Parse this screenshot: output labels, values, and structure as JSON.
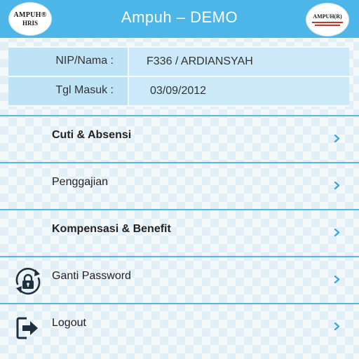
{
  "header": {
    "title": "Ampuh – DEMO",
    "logo_left_line1": "AMPUH®",
    "logo_left_line2": "HRIS",
    "logo_right_text": "AMPUH(R)",
    "background_color": "#4bb6e7"
  },
  "info": {
    "rows": [
      {
        "label": "NIP/Nama :",
        "value": "F336 / ARDIANSYAH"
      },
      {
        "label": "Tgl Masuk :",
        "value": "03/09/2012"
      }
    ]
  },
  "menu": {
    "items": [
      {
        "label": "Cuti & Absensi",
        "icon": "none"
      },
      {
        "label": "Penggajian",
        "icon": "none"
      },
      {
        "label": "Kompensasi & Benefit",
        "icon": "none"
      },
      {
        "label": "Ganti Password",
        "icon": "lock-refresh-icon"
      },
      {
        "label": "Logout",
        "icon": "logout-icon"
      }
    ],
    "chevron_icon": "chevron-right-icon",
    "accent_color": "#55b8e3"
  }
}
